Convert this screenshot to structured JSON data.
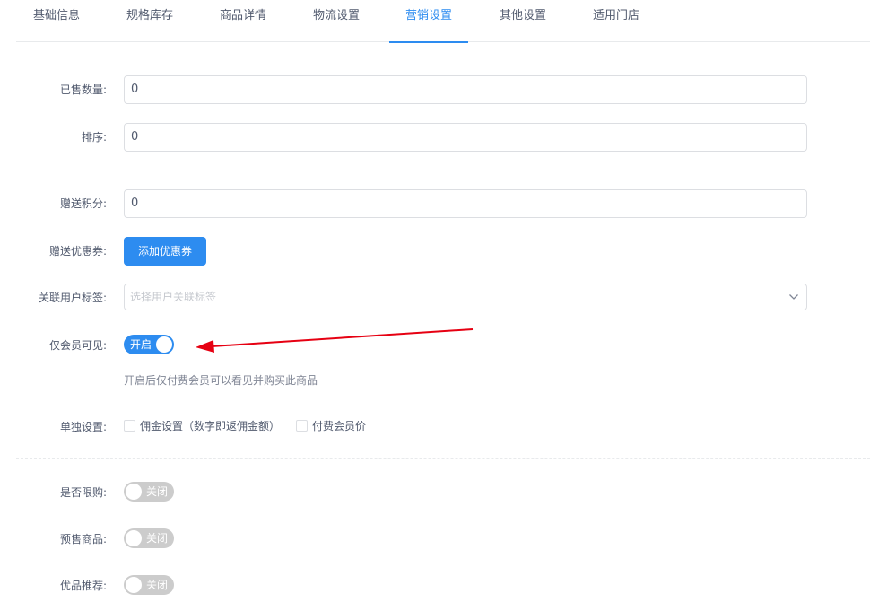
{
  "tabs": [
    {
      "label": "基础信息"
    },
    {
      "label": "规格库存"
    },
    {
      "label": "商品详情"
    },
    {
      "label": "物流设置"
    },
    {
      "label": "营销设置",
      "active": true
    },
    {
      "label": "其他设置"
    },
    {
      "label": "适用门店"
    }
  ],
  "form": {
    "sold_count": {
      "label": "已售数量:",
      "value": "0"
    },
    "sort": {
      "label": "排序:",
      "value": "0"
    },
    "give_points": {
      "label": "赠送积分:",
      "value": "0"
    },
    "give_coupon": {
      "label": "赠送优惠券:",
      "button": "添加优惠券"
    },
    "user_tag": {
      "label": "关联用户标签:",
      "placeholder": "选择用户关联标签"
    },
    "member_only": {
      "label": "仅会员可见:",
      "state": "开启",
      "hint": "开启后仅付费会员可以看见并购买此商品"
    },
    "separate": {
      "label": "单独设置:",
      "options": [
        "佣金设置（数字即返佣金额）",
        "付费会员价"
      ]
    },
    "limit_buy": {
      "label": "是否限购:",
      "state": "关闭"
    },
    "presale": {
      "label": "预售商品:",
      "state": "关闭"
    },
    "recommend": {
      "label": "优品推荐:",
      "state": "关闭"
    }
  },
  "colors": {
    "accent": "#2d8cf0",
    "switch_off": "#cccccc",
    "annotation_arrow": "#e60012"
  },
  "icons": {
    "select_chevron": "chevron-down-icon"
  }
}
